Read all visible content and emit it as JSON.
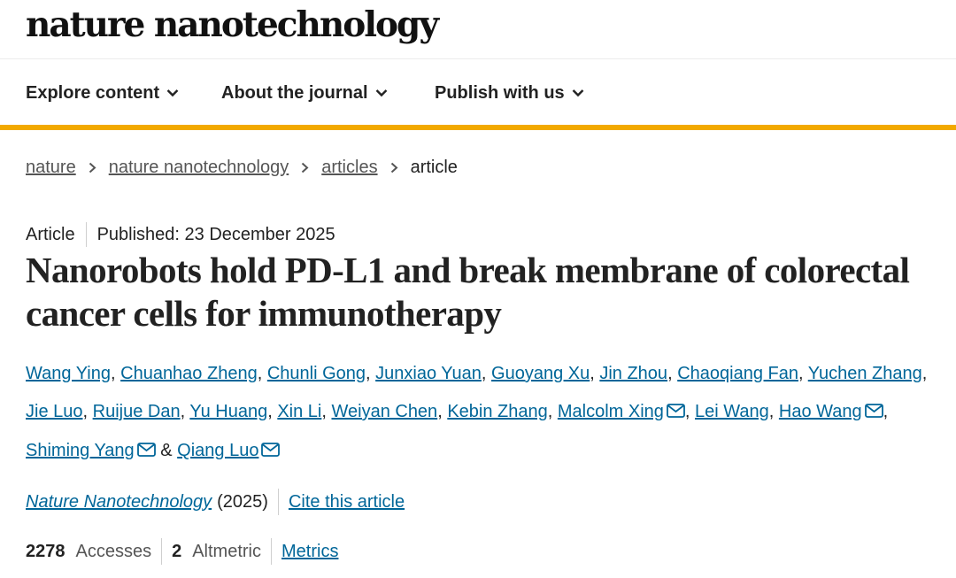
{
  "site": {
    "brand": "nature nanotechnology"
  },
  "nav": {
    "items": [
      {
        "label": "Explore content",
        "icon": "chevron-down-icon"
      },
      {
        "label": "About the journal",
        "icon": "chevron-down-icon"
      },
      {
        "label": "Publish with us",
        "icon": "chevron-down-icon"
      }
    ]
  },
  "colors": {
    "accent": "#f2a900",
    "link": "#006699",
    "text": "#222222"
  },
  "breadcrumb": {
    "items": [
      "nature",
      "nature nanotechnology",
      "articles"
    ],
    "current": "article"
  },
  "article": {
    "type": "Article",
    "published": "Published: 23 December 2025",
    "title": "Nanorobots hold PD-L1 and break membrane of colorectal cancer cells for immunotherapy",
    "authors": [
      {
        "name": "Wang Ying",
        "corresponding": false
      },
      {
        "name": "Chuanhao Zheng",
        "corresponding": false
      },
      {
        "name": "Chunli Gong",
        "corresponding": false
      },
      {
        "name": "Junxiao Yuan",
        "corresponding": false
      },
      {
        "name": "Guoyang Xu",
        "corresponding": false
      },
      {
        "name": "Jin Zhou",
        "corresponding": false
      },
      {
        "name": "Chaoqiang Fan",
        "corresponding": false
      },
      {
        "name": "Yuchen Zhang",
        "corresponding": false
      },
      {
        "name": "Jie Luo",
        "corresponding": false
      },
      {
        "name": "Ruijue Dan",
        "corresponding": false
      },
      {
        "name": "Yu Huang",
        "corresponding": false
      },
      {
        "name": "Xin Li",
        "corresponding": false
      },
      {
        "name": "Weiyan Chen",
        "corresponding": false
      },
      {
        "name": "Kebin Zhang",
        "corresponding": false
      },
      {
        "name": "Malcolm Xing",
        "corresponding": true
      },
      {
        "name": "Lei Wang",
        "corresponding": false
      },
      {
        "name": "Hao Wang",
        "corresponding": true
      },
      {
        "name": "Shiming Yang",
        "corresponding": true
      },
      {
        "name": "Qiang Luo",
        "corresponding": true
      }
    ],
    "author_separator": ", ",
    "author_last_joiner": " & ",
    "journal": "Nature Nanotechnology",
    "year": "(2025)",
    "cite_label": "Cite this article",
    "accesses": "2278",
    "accesses_label": "Accesses",
    "altmetric": "2",
    "altmetric_label": "Altmetric",
    "metrics_label": "Metrics"
  }
}
